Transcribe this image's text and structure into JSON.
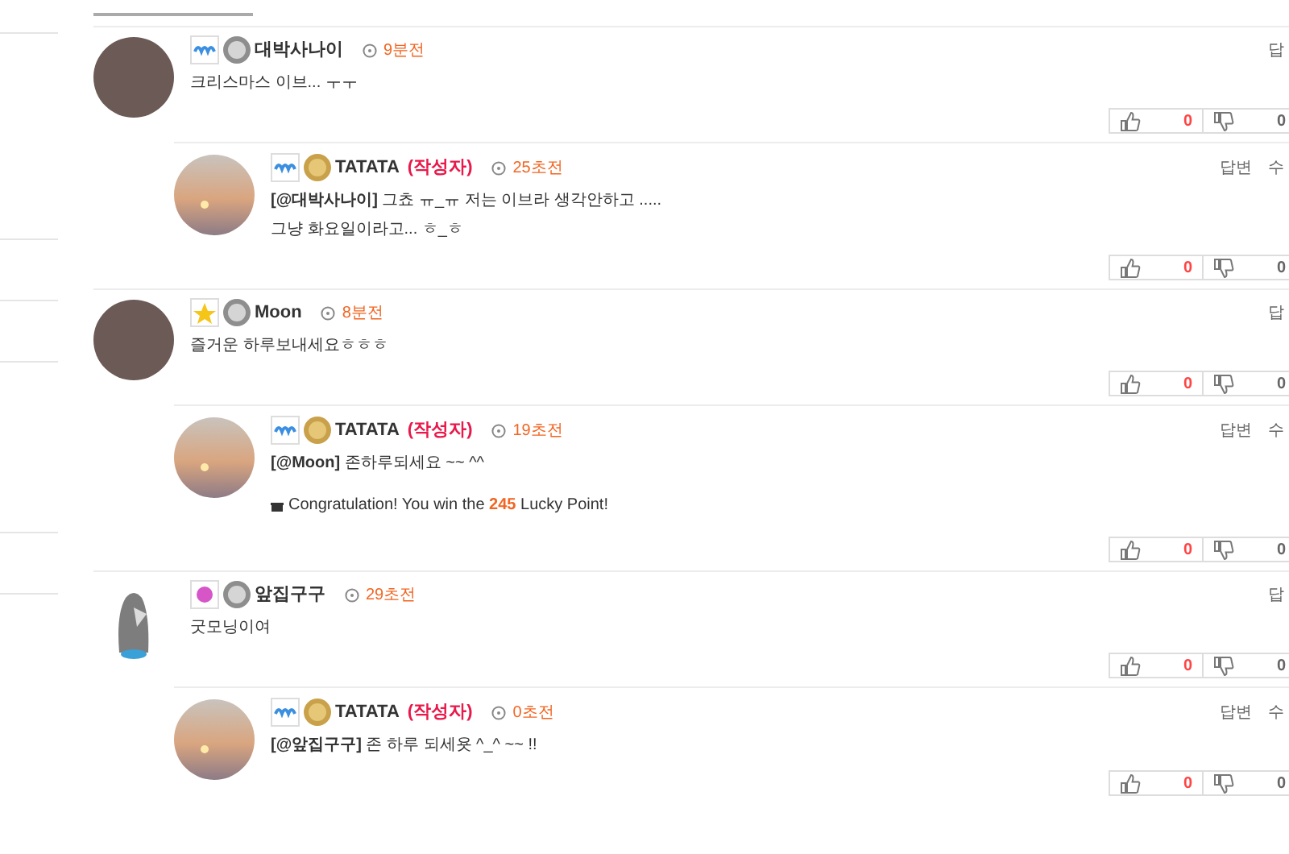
{
  "comments": [
    {
      "avatar": {
        "kind": "photo"
      },
      "badges": [
        {
          "kind": "wave"
        },
        {
          "kind": "silver"
        }
      ],
      "name": "대박사나이",
      "time": "9분전",
      "text": "크리스마스 이브... ㅜㅜ",
      "actions": [
        "답"
      ],
      "votes": {
        "up": "0",
        "down": "0"
      },
      "replies": [
        {
          "avatar": {
            "kind": "sunset"
          },
          "badges": [
            {
              "kind": "wave"
            },
            {
              "kind": "gold"
            }
          ],
          "name": "TATATA",
          "author_tag": "(작성자)",
          "time": "25초전",
          "text": "**[@대박사나이]** 그쵸 ㅠ_ㅠ 저는 이브라 생각안하고 .....",
          "text_2": "그냥 화요일이라고... ㅎ_ㅎ",
          "actions": [
            "답변",
            "수"
          ],
          "votes": {
            "up": "0",
            "down": "0"
          }
        }
      ]
    },
    {
      "avatar": {
        "kind": "photo"
      },
      "badges": [
        {
          "kind": "star"
        },
        {
          "kind": "silver"
        }
      ],
      "name": "Moon",
      "time": "8분전",
      "text": "즐거운 하루보내세요ㅎㅎㅎ",
      "actions": [
        "답"
      ],
      "votes": {
        "up": "0",
        "down": "0"
      },
      "replies": [
        {
          "avatar": {
            "kind": "sunset"
          },
          "badges": [
            {
              "kind": "wave"
            },
            {
              "kind": "gold"
            }
          ],
          "name": "TATATA",
          "author_tag": "(작성자)",
          "time": "19초전",
          "text": "**[@Moon]** 존하루되세요 ~~ ^^",
          "lucky": "Congratulation! You win the **245** Lucky Point!",
          "actions": [
            "답변",
            "수"
          ],
          "votes": {
            "up": "0",
            "down": "0"
          }
        }
      ]
    },
    {
      "avatar": {
        "kind": "character"
      },
      "badges": [
        {
          "kind": "flower"
        },
        {
          "kind": "silver"
        }
      ],
      "name": "앞집구구",
      "time": "29초전",
      "text": "굿모닝이여",
      "actions": [
        "답"
      ],
      "votes": {
        "up": "0",
        "down": "0"
      },
      "replies": [
        {
          "avatar": {
            "kind": "sunset"
          },
          "badges": [
            {
              "kind": "wave"
            },
            {
              "kind": "gold"
            }
          ],
          "name": "TATATA",
          "author_tag": "(작성자)",
          "time": "0초전",
          "text": "**[@앞집구구]** 존 하루 되세욧 ^_^ ~~ !!",
          "actions": [
            "답변",
            "수"
          ],
          "votes": {
            "up": "0",
            "down": "0"
          }
        }
      ]
    }
  ]
}
